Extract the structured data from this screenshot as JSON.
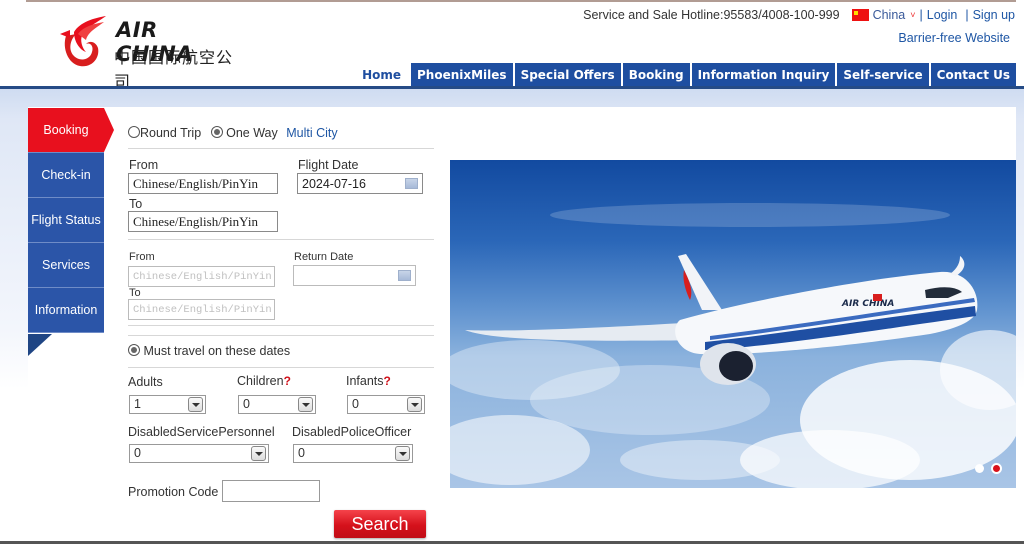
{
  "header": {
    "logo_en": "AIR CHINA",
    "logo_cn": "中国国际航空公司",
    "hotline": "Service and Sale Hotline:95583/4008-100-999",
    "country": "China",
    "login": "Login",
    "signup": "Sign up",
    "barrier_free": "Barrier-free Website",
    "separator": "|"
  },
  "nav": {
    "items": [
      {
        "label": "Home",
        "active": true
      },
      {
        "label": "PhoenixMiles"
      },
      {
        "label": "Special Offers"
      },
      {
        "label": "Booking"
      },
      {
        "label": "Information Inquiry"
      },
      {
        "label": "Self-service"
      },
      {
        "label": "Contact Us"
      }
    ]
  },
  "side_tabs": {
    "items": [
      {
        "label": "Booking",
        "active": true
      },
      {
        "label": "Check-in"
      },
      {
        "label": "Flight Status"
      },
      {
        "label": "Services"
      },
      {
        "label": "Information"
      }
    ]
  },
  "booking_form": {
    "trip_types": {
      "round_trip": "Round Trip",
      "one_way": "One Way",
      "multi_city": "Multi City",
      "selected": "One Way"
    },
    "from_label": "From",
    "to_label": "To",
    "from_value": "Chinese/English/PinYin",
    "to_value": "Chinese/English/PinYin",
    "flight_date_label": "Flight Date",
    "flight_date_value": "2024-07-16",
    "return_from_label": "From",
    "return_to_label": "To",
    "return_from_placeholder": "Chinese/English/PinYin",
    "return_to_placeholder": "Chinese/English/PinYin",
    "return_date_label": "Return Date",
    "return_date_value": "",
    "must_travel_label": "Must travel on these dates",
    "must_travel_checked": true,
    "adults_label": "Adults",
    "adults_value": "1",
    "children_label": "Children",
    "children_value": "0",
    "infants_label": "Infants",
    "infants_value": "0",
    "help_mark": "?",
    "disabled_service_label": "DisabledServicePersonnel",
    "disabled_service_value": "0",
    "disabled_police_label": "DisabledPoliceOfficer",
    "disabled_police_value": "0",
    "promo_label": "Promotion Code",
    "promo_value": "",
    "search_label": "Search"
  },
  "banner": {
    "slides": 2,
    "active_slide": 2,
    "livery_text": "AIR CHINA"
  },
  "colors": {
    "brand_red": "#e8101e",
    "brand_blue": "#1e4ea0",
    "link_blue": "#1e56a4"
  }
}
